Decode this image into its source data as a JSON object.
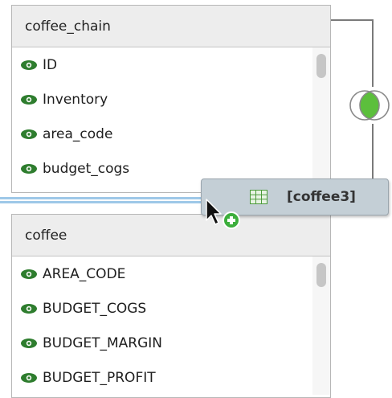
{
  "tables": [
    {
      "name": "coffee_chain",
      "fields": [
        "ID",
        "Inventory",
        "area_code",
        "budget_cogs"
      ]
    },
    {
      "name": "coffee",
      "fields": [
        "AREA_CODE",
        "BUDGET_COGS",
        "BUDGET_MARGIN",
        "BUDGET_PROFIT"
      ]
    }
  ],
  "drag_tooltip": {
    "label": "[coffee3]"
  },
  "colors": {
    "eye_icon": "#2e7d2e",
    "join_fill": "#5cbf3c",
    "drop_line": "#9ec8e8",
    "add_badge": "#3cae3c"
  },
  "icons": {
    "field": "eye-icon",
    "join": "inner-join-icon",
    "table": "grid-table-icon",
    "cursor": "pointer-cursor-icon",
    "add": "plus-badge-icon"
  }
}
